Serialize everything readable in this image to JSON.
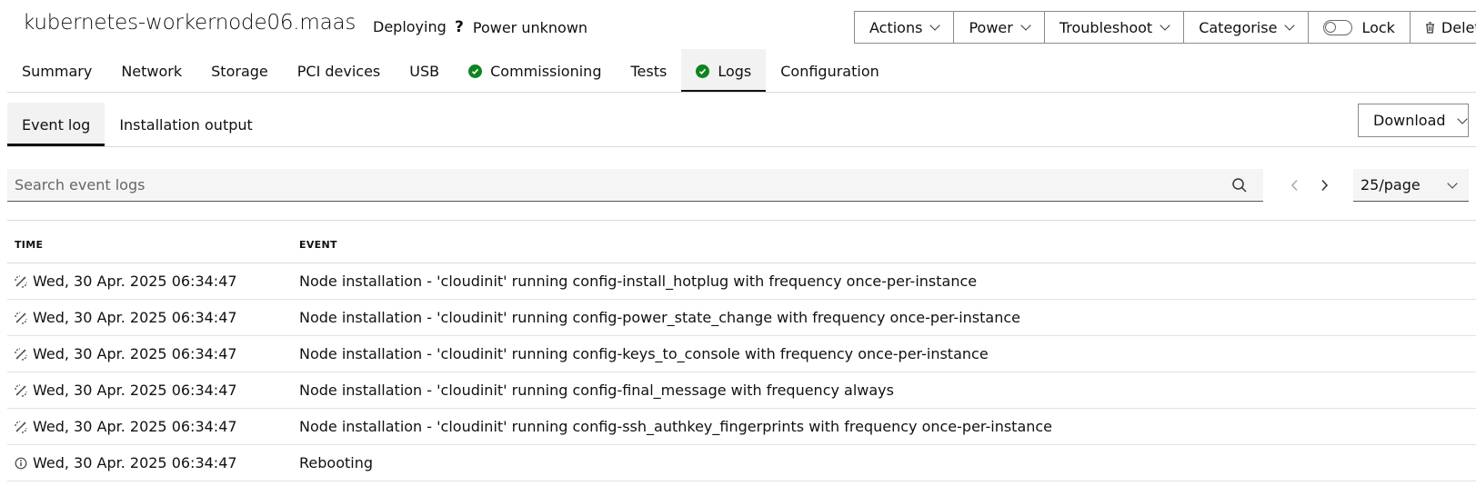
{
  "header": {
    "title": "kubernetes-workernode06.maas",
    "status": "Deploying",
    "power_glyph": "?",
    "power": "Power unknown"
  },
  "actions": {
    "actions_label": "Actions",
    "power_label": "Power",
    "troubleshoot_label": "Troubleshoot",
    "categorise_label": "Categorise",
    "lock_label": "Lock",
    "delete_label": "Delete"
  },
  "tabs": [
    {
      "label": "Summary"
    },
    {
      "label": "Network"
    },
    {
      "label": "Storage"
    },
    {
      "label": "PCI devices"
    },
    {
      "label": "USB"
    },
    {
      "label": "Commissioning"
    },
    {
      "label": "Tests"
    },
    {
      "label": "Logs"
    },
    {
      "label": "Configuration"
    }
  ],
  "subtabs": [
    {
      "label": "Event log"
    },
    {
      "label": "Installation output"
    }
  ],
  "download_label": "Download",
  "search": {
    "placeholder": "Search event logs"
  },
  "pagination": {
    "per_page": "25/page"
  },
  "table": {
    "headers": {
      "time": "TIME",
      "event": "EVENT"
    },
    "rows": [
      {
        "icon": "in-progress-icon",
        "time": "Wed, 30 Apr. 2025 06:34:47",
        "event": "Node installation - 'cloudinit' running config-install_hotplug with frequency once-per-instance"
      },
      {
        "icon": "in-progress-icon",
        "time": "Wed, 30 Apr. 2025 06:34:47",
        "event": "Node installation - 'cloudinit' running config-power_state_change with frequency once-per-instance"
      },
      {
        "icon": "in-progress-icon",
        "time": "Wed, 30 Apr. 2025 06:34:47",
        "event": "Node installation - 'cloudinit' running config-keys_to_console with frequency once-per-instance"
      },
      {
        "icon": "in-progress-icon",
        "time": "Wed, 30 Apr. 2025 06:34:47",
        "event": "Node installation - 'cloudinit' running config-final_message with frequency always"
      },
      {
        "icon": "in-progress-icon",
        "time": "Wed, 30 Apr. 2025 06:34:47",
        "event": "Node installation - 'cloudinit' running config-ssh_authkey_fingerprints with frequency once-per-instance"
      },
      {
        "icon": "info-icon",
        "time": "Wed, 30 Apr. 2025 06:34:47",
        "event": "Rebooting"
      }
    ]
  },
  "colors": {
    "success": "#0e8420",
    "text": "#111111",
    "border": "#8a8a8a",
    "active_tab_bg": "#f2f2f2"
  }
}
